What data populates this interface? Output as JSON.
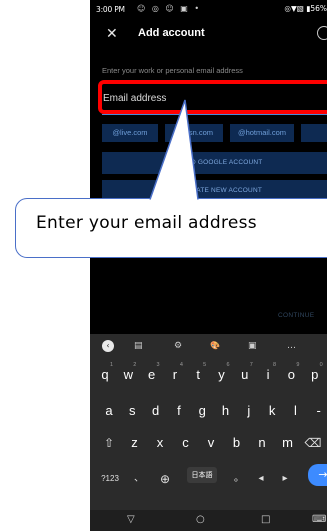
{
  "status_bar": {
    "time": "3:00 PM",
    "notification_icons": "☺ ◎ ☺ ▣ •",
    "system_icons": "◎▼▧ ▮56%"
  },
  "header": {
    "close_icon": "✕",
    "title": "Add account"
  },
  "form": {
    "prompt": "Enter your work or personal email address",
    "email_placeholder": "Email address"
  },
  "domain_chips": [
    "@live.com",
    "@msn.com",
    "@hotmail.com",
    ""
  ],
  "actions": {
    "add_google": "ADD GOOGLE ACCOUNT",
    "create_new": "CREATE NEW ACCOUNT",
    "continue": "CONTINUE"
  },
  "callout": {
    "text": "Enter your email address"
  },
  "keyboard": {
    "toolbar": [
      "▤",
      "⚙",
      "🎨",
      "▣",
      "…"
    ],
    "row1": [
      {
        "key": "q",
        "num": "1"
      },
      {
        "key": "w",
        "num": "2"
      },
      {
        "key": "e",
        "num": "3"
      },
      {
        "key": "r",
        "num": "4"
      },
      {
        "key": "t",
        "num": "5"
      },
      {
        "key": "y",
        "num": "6"
      },
      {
        "key": "u",
        "num": "7"
      },
      {
        "key": "i",
        "num": "8"
      },
      {
        "key": "o",
        "num": "9"
      },
      {
        "key": "p",
        "num": "0"
      }
    ],
    "row2": [
      "a",
      "s",
      "d",
      "f",
      "g",
      "h",
      "j",
      "k",
      "l",
      "-"
    ],
    "row3": [
      "⇧",
      "z",
      "x",
      "c",
      "v",
      "b",
      "n",
      "m",
      "⌫"
    ],
    "row4": {
      "sym": "?123",
      "comma": "、",
      "globe": "⊕",
      "lang": "日本語",
      "period": "。",
      "left": "◂",
      "right": "▸",
      "enter": "→"
    }
  },
  "nav_bar": {
    "back": "▽",
    "home": "○",
    "recents": "□",
    "keyboard": "⌨"
  },
  "colors": {
    "highlight": "#ff0000",
    "accent": "#3d8bff",
    "chip_bg": "#0e2a52",
    "callout_border": "#4a6fc8"
  }
}
